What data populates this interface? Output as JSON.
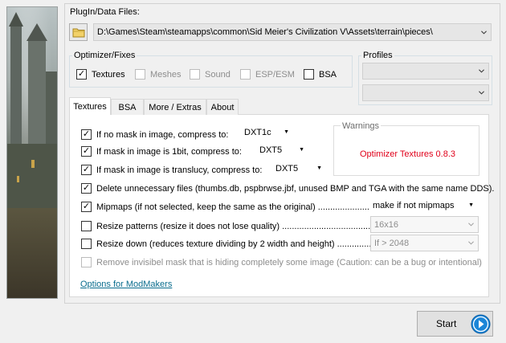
{
  "plugin": {
    "label": "PlugIn/Data Files:",
    "path": "D:\\Games\\Steam\\steamapps\\common\\Sid Meier's Civilization V\\Assets\\terrain\\pieces\\"
  },
  "optimizer": {
    "label": "Optimizer/Fixes",
    "options": [
      {
        "label": "Textures",
        "checked": true,
        "enabled": true
      },
      {
        "label": "Meshes",
        "checked": false,
        "enabled": false
      },
      {
        "label": "Sound",
        "checked": false,
        "enabled": false
      },
      {
        "label": "ESP/ESM",
        "checked": false,
        "enabled": false
      },
      {
        "label": "BSA",
        "checked": false,
        "enabled": true
      }
    ]
  },
  "profiles": {
    "label": "Profiles",
    "select1": "",
    "select2": ""
  },
  "tabs": [
    "Textures",
    "BSA",
    "More / Extras",
    "About"
  ],
  "active_tab": "Textures",
  "textures": {
    "compress_nomask": {
      "label": "If no mask in image, compress to:",
      "value": "DXT1c",
      "checked": true
    },
    "compress_1bit": {
      "label": "If mask in image is 1bit, compress to:",
      "value": "DXT5",
      "checked": true
    },
    "compress_translucy": {
      "label": "If mask in image is translucy, compress to:",
      "value": "DXT5",
      "checked": true
    },
    "delete_files": {
      "label": "Delete unnecessary files (thumbs.db, pspbrwse.jbf, unused BMP and TGA with the same name DDS).",
      "checked": true
    },
    "mipmaps": {
      "label": "Mipmaps (if not selected, keep the same as the original) .........................",
      "value": "make if not mipmaps",
      "checked": true
    },
    "resize_patterns": {
      "label": "Resize patterns (resize it does not lose quality) .................................................",
      "value": "16x16",
      "checked": false
    },
    "resize_down": {
      "label": "Resize down (reduces texture dividing by 2 width and height) ..................",
      "value": "If > 2048",
      "checked": false
    },
    "remove_mask": {
      "label": "Remove invisibel mask that is hiding completely some image (Caution: can be a bug or intentional)",
      "checked": false
    },
    "modmakers_link": "Options for ModMakers"
  },
  "warnings": {
    "label": "Warnings",
    "message": "Optimizer Textures 0.8.3",
    "message_color": "#e0001a"
  },
  "start_button": "Start",
  "colors": {
    "accent_blue": "#1b86d8",
    "link": "#0b6d8e"
  }
}
